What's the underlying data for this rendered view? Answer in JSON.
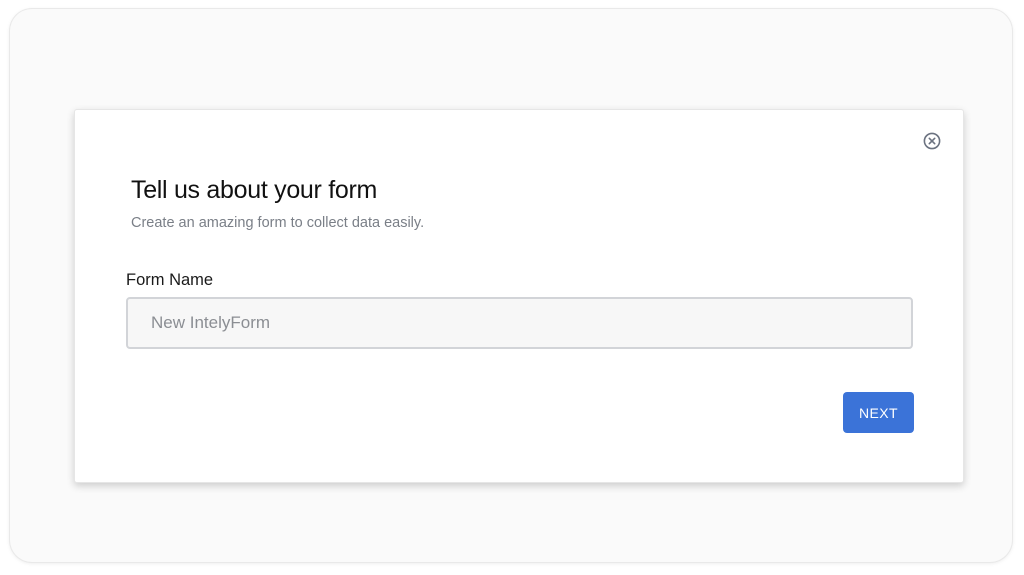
{
  "dialog": {
    "title": "Tell us about your form",
    "subtitle": "Create an amazing form to collect data easily.",
    "close_icon": "close-circle-icon",
    "form_name": {
      "label": "Form Name",
      "value": "",
      "placeholder": "New IntelyForm"
    },
    "next_label": "NEXT"
  },
  "colors": {
    "accent": "#3b73d8",
    "input_border": "#d2d4d8",
    "input_background": "#f7f7f7",
    "subtitle": "#7a7f87",
    "icon": "#6b7280"
  }
}
